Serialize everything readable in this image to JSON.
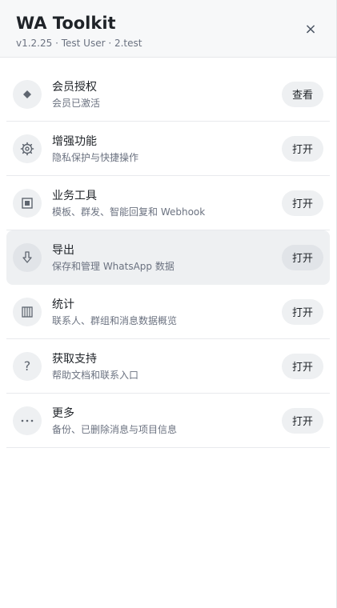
{
  "header": {
    "title": "WA Toolkit",
    "subtitle": "v1.2.25 · Test User · 2.test",
    "close_icon": "×"
  },
  "items": [
    {
      "icon": "diamond-icon",
      "label": "会员授权",
      "desc": "会员已激活",
      "action": "查看"
    },
    {
      "icon": "gear-icon",
      "label": "增强功能",
      "desc": "隐私保护与快捷操作",
      "action": "打开"
    },
    {
      "icon": "square-box-icon",
      "label": "业务工具",
      "desc": "模板、群发、智能回复和 Webhook",
      "action": "打开"
    },
    {
      "icon": "download-arrow-icon",
      "label": "导出",
      "desc": "保存和管理 WhatsApp 数据",
      "action": "打开",
      "active": true
    },
    {
      "icon": "columns-icon",
      "label": "统计",
      "desc": "联系人、群组和消息数据概览",
      "action": "打开"
    },
    {
      "icon": "question-icon",
      "label": "获取支持",
      "desc": "帮助文档和联系入口",
      "action": "打开"
    },
    {
      "icon": "more-dots-icon",
      "label": "更多",
      "desc": "备份、已删除消息与项目信息",
      "action": "打开"
    }
  ]
}
